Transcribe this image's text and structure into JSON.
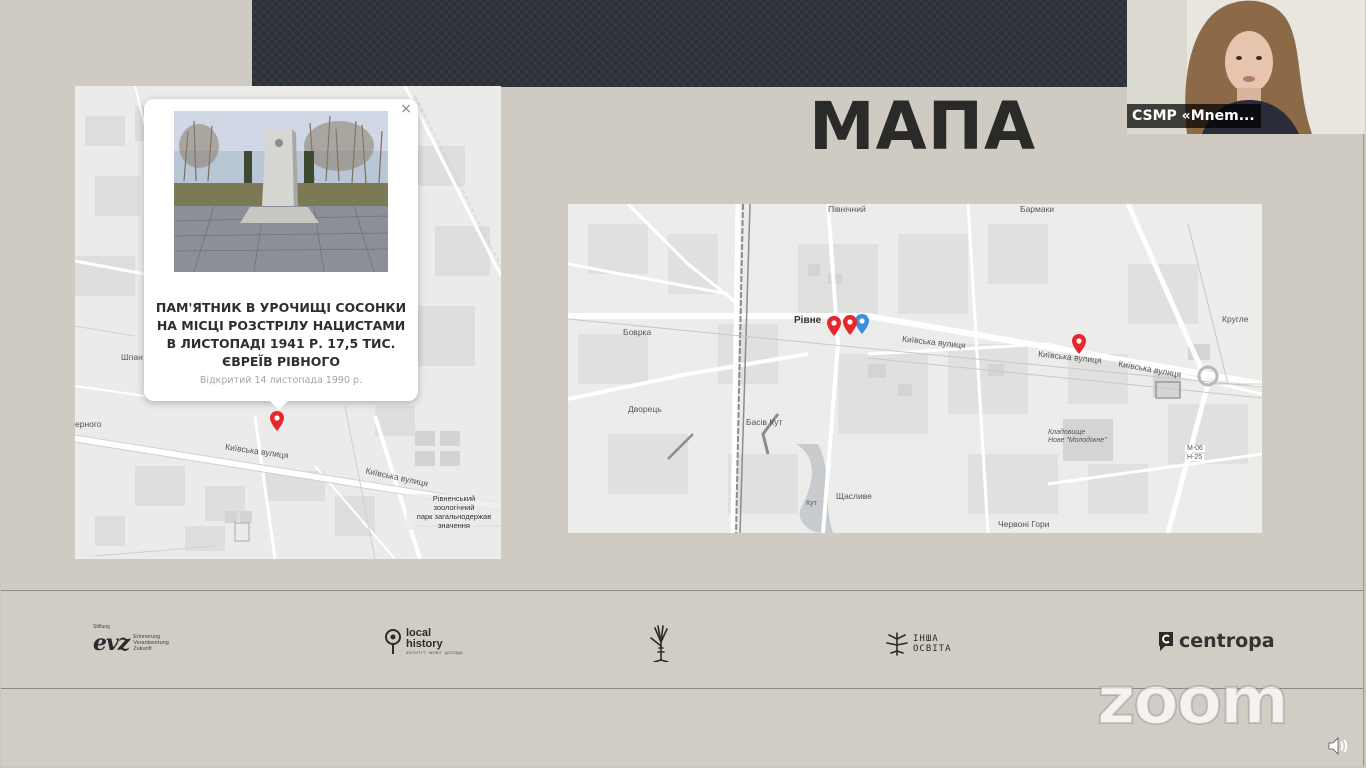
{
  "slide": {
    "title": "МАПА"
  },
  "popup": {
    "title": "ПАМ'ЯТНИК В УРОЧИЩІ СОСОНКИ НА МІСЦІ РОЗСТРІЛУ НАЦИСТАМИ В ЛИСТОПАДІ 1941 Р. 17,5 ТИС. ЄВРЕЇВ РІВНОГО",
    "subtitle": "Відкритий 14 листопада 1990 р.",
    "close": "×"
  },
  "left_map": {
    "labels": {
      "street_kyivska": "Київська вулиця",
      "street_kyivska_2": "Київська вулиця",
      "shpan": "Шпан",
      "edge": "ерного",
      "zoo": "Рівненський\nзоологічний\nпарк загальнодержав\nзначення"
    }
  },
  "right_map": {
    "labels": {
      "rivne": "Рівне",
      "bovrka": "Боврка",
      "dvorets": "Дворець",
      "basiv_kut": "Басів Кут",
      "shchaslyve": "Щасливе",
      "chervoni_hory": "Червоні Гори",
      "pivnichnyi": "Північний",
      "barmaky": "Бармаки",
      "kruhle": "Кругле",
      "kyivska_1": "Київська вулиця",
      "kyivska_2": "Київська вулиця",
      "m06": "М-06",
      "n25": "Н-25",
      "kladovyshche": "Кладовище\nНове \"Молодіжне\"",
      "kut": "Кут"
    }
  },
  "partners": {
    "evz": {
      "mark": "evz",
      "sup": "Stiftung",
      "line1": "Erinnerung",
      "line2": "Verantwortung",
      "line3": "Zukunft"
    },
    "local_history": {
      "line1": "local",
      "line2": "history",
      "sub": "ІНСТИТУТ · МУЗЕЇ · ДОСЛІДИ"
    },
    "inshe": {
      "line1": "ІНША",
      "line2": "ОСВІТА"
    },
    "centropa": {
      "text": "centropa"
    }
  },
  "webcam": {
    "participant": "CSMP «Mnem..."
  },
  "watermark": "zoom",
  "colors": {
    "pin_red": "#e8272a",
    "pin_blue": "#3a8fe0",
    "band_dark": "#2b3036",
    "slide_bg": "#d1cdc4"
  }
}
